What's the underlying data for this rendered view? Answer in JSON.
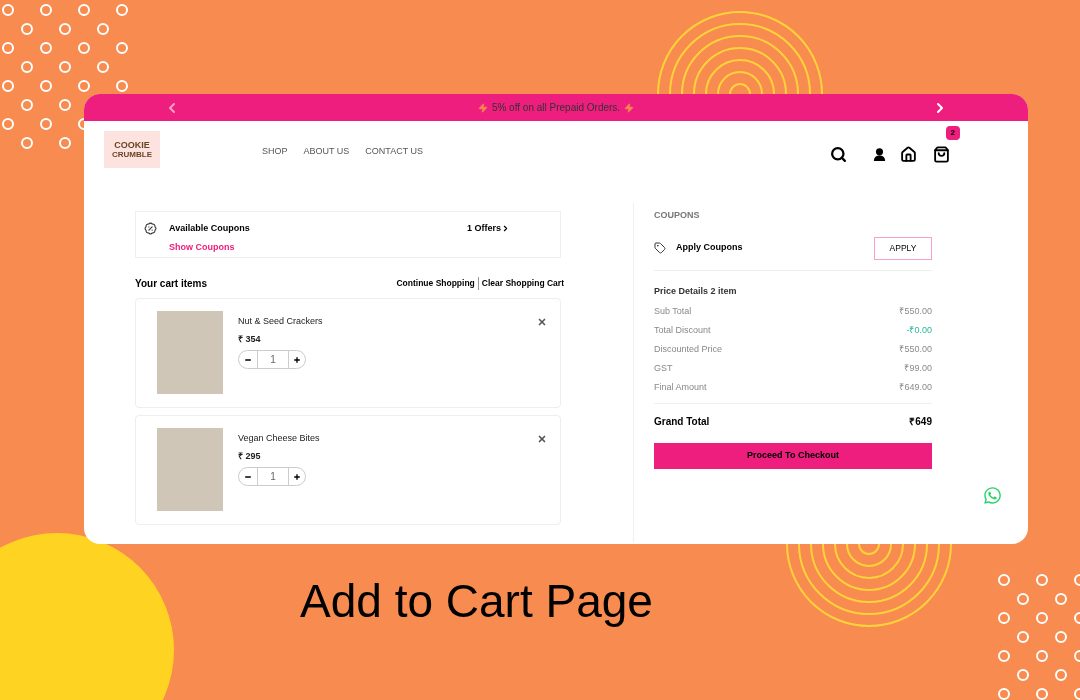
{
  "announcement": {
    "text": "5% off on all Prepaid Orders."
  },
  "logo": {
    "line_1": "COOKIE",
    "line_2": "CRUMBLE"
  },
  "nav": [
    {
      "label": "SHOP"
    },
    {
      "label": "ABOUT US"
    },
    {
      "label": "CONTACT US"
    }
  ],
  "cart_badge": "2",
  "coupons_box": {
    "title": "Available Coupons",
    "link": "Show Coupons",
    "offers": "1 Offers"
  },
  "cart": {
    "heading": "Your cart items",
    "actions": [
      "Continue Shopping",
      "Clear Shopping Cart"
    ],
    "items": [
      {
        "name": "Nut & Seed Crackers",
        "price": "₹ 354",
        "quantity": "1"
      },
      {
        "name": "Vegan Cheese Bites",
        "price": "₹ 295",
        "quantity": "1"
      }
    ]
  },
  "summary": {
    "heading": "COUPONS",
    "apply_label": "Apply Coupons",
    "apply_button": "APPLY",
    "details_heading": "Price Details 2 item",
    "rows": [
      {
        "label": "Sub Total",
        "value": "₹550.00",
        "kind": "normal"
      },
      {
        "label": "Total Discount",
        "value": "-₹0.00",
        "kind": "discount"
      },
      {
        "label": "Discounted Price",
        "value": "₹550.00",
        "kind": "normal"
      },
      {
        "label": "GST",
        "value": "₹99.00",
        "kind": "normal"
      },
      {
        "label": "Final Amount",
        "value": "₹649.00",
        "kind": "normal"
      }
    ],
    "grand_total_label": "Grand Total",
    "grand_total": "₹649",
    "checkout": "Proceed To Checkout"
  },
  "caption": "Add to Cart Page"
}
